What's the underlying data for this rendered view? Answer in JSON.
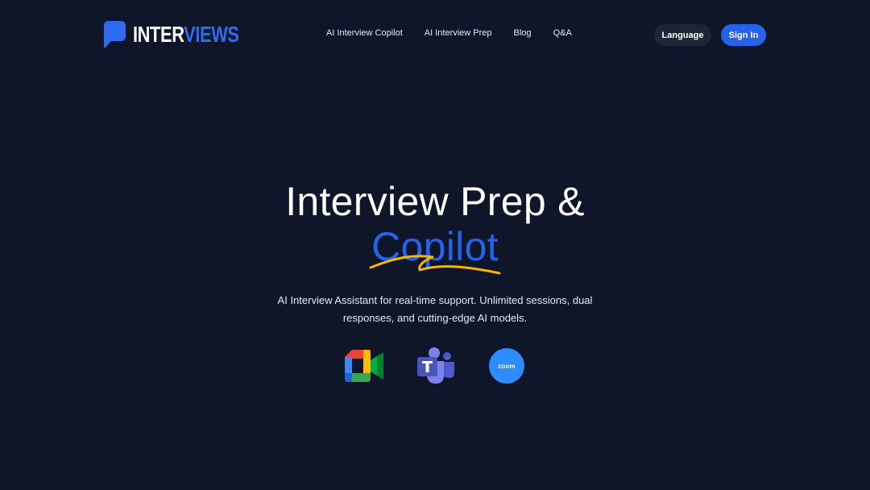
{
  "brand": {
    "name_part1": "INTER",
    "name_part2": "VIEWS",
    "accent_color": "#2563eb"
  },
  "nav": {
    "items": [
      {
        "label": "AI Interview Copilot"
      },
      {
        "label": "AI Interview Prep"
      },
      {
        "label": "Blog"
      },
      {
        "label": "Q&A"
      }
    ]
  },
  "header": {
    "language_label": "Language",
    "signin_label": "Sign In"
  },
  "hero": {
    "title_line1": "Interview Prep &",
    "title_line2": "Copilot",
    "subtitle_line1": "AI Interview Assistant for real-time support. Unlimited sessions, dual",
    "subtitle_line2": "responses, and cutting-edge AI models."
  },
  "integrations": [
    {
      "icon": "google-meet-icon"
    },
    {
      "icon": "microsoft-teams-icon"
    },
    {
      "icon": "zoom-icon",
      "label": "zoom"
    }
  ],
  "colors": {
    "background": "#0f1629",
    "underline": "#f5b800",
    "language_button": "#1e2536",
    "signin_button": "#2563eb"
  }
}
